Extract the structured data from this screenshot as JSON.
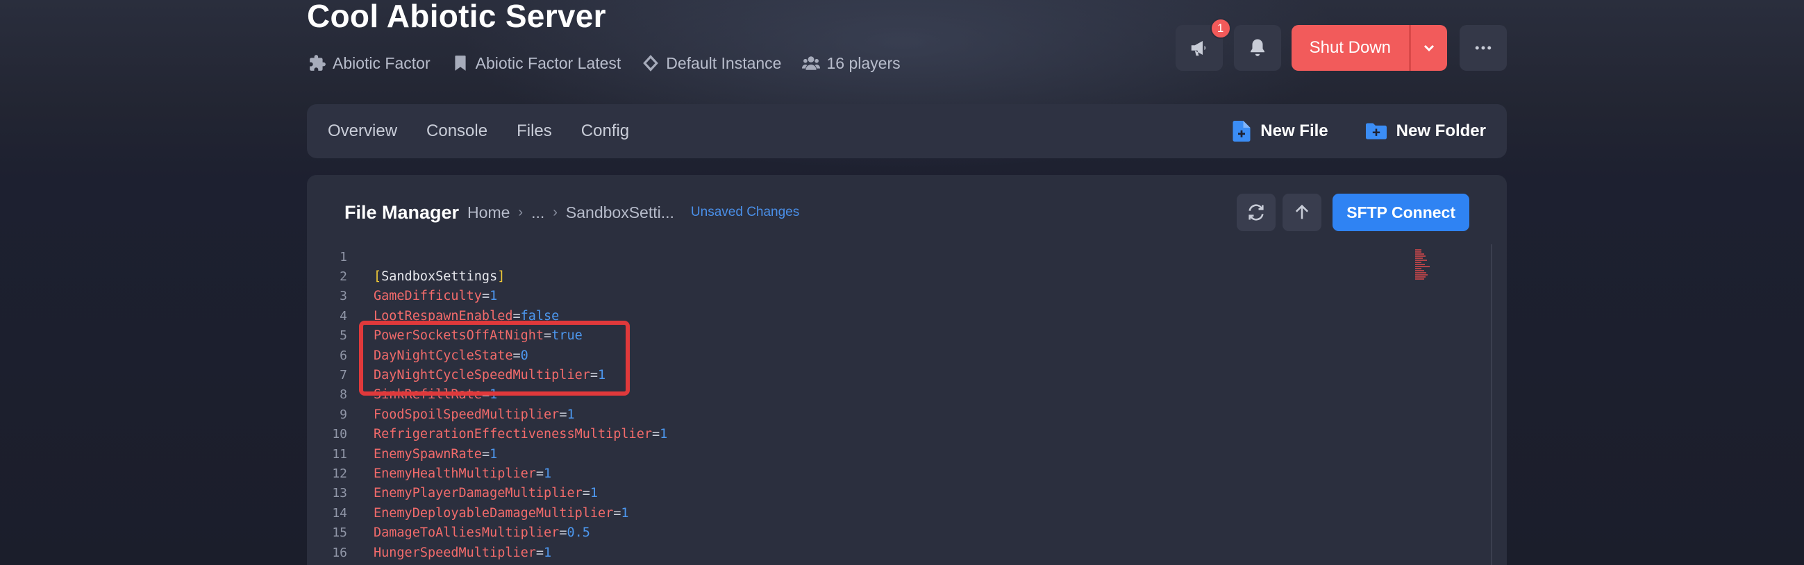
{
  "header": {
    "title": "Cool Abiotic Server",
    "meta": [
      {
        "icon": "puzzle-icon",
        "label": "Abiotic Factor"
      },
      {
        "icon": "bookmark-icon",
        "label": "Abiotic Factor Latest"
      },
      {
        "icon": "layers-icon",
        "label": "Default Instance"
      },
      {
        "icon": "users-icon",
        "label": "16 players"
      }
    ],
    "announce_badge": "1",
    "shutdown_label": "Shut Down"
  },
  "nav": {
    "tabs": [
      "Overview",
      "Console",
      "Files",
      "Config"
    ],
    "new_file_label": "New File",
    "new_folder_label": "New Folder"
  },
  "file_manager": {
    "title": "File Manager",
    "breadcrumbs": [
      "Home",
      "...",
      "SandboxSetti..."
    ],
    "status": "Unsaved Changes",
    "sftp_label": "SFTP Connect"
  },
  "editor": {
    "section_header": "SandboxSettings",
    "lines": [
      {
        "num": "1",
        "key": "",
        "value": "",
        "type": "empty"
      },
      {
        "num": "2",
        "key": "SandboxSettings",
        "value": "",
        "type": "section"
      },
      {
        "num": "3",
        "key": "GameDifficulty",
        "value": "1",
        "type": "kv"
      },
      {
        "num": "4",
        "key": "LootRespawnEnabled",
        "value": "false",
        "type": "kv"
      },
      {
        "num": "5",
        "key": "PowerSocketsOffAtNight",
        "value": "true",
        "type": "kv"
      },
      {
        "num": "6",
        "key": "DayNightCycleState",
        "value": "0",
        "type": "kv"
      },
      {
        "num": "7",
        "key": "DayNightCycleSpeedMultiplier",
        "value": "1",
        "type": "kv"
      },
      {
        "num": "8",
        "key": "SinkRefillRate",
        "value": "1",
        "type": "kv"
      },
      {
        "num": "9",
        "key": "FoodSpoilSpeedMultiplier",
        "value": "1",
        "type": "kv"
      },
      {
        "num": "10",
        "key": "RefrigerationEffectivenessMultiplier",
        "value": "1",
        "type": "kv"
      },
      {
        "num": "11",
        "key": "EnemySpawnRate",
        "value": "1",
        "type": "kv"
      },
      {
        "num": "12",
        "key": "EnemyHealthMultiplier",
        "value": "1",
        "type": "kv"
      },
      {
        "num": "13",
        "key": "EnemyPlayerDamageMultiplier",
        "value": "1",
        "type": "kv"
      },
      {
        "num": "14",
        "key": "EnemyDeployableDamageMultiplier",
        "value": "1",
        "type": "kv"
      },
      {
        "num": "15",
        "key": "DamageToAlliesMultiplier",
        "value": "0.5",
        "type": "kv"
      },
      {
        "num": "16",
        "key": "HungerSpeedMultiplier",
        "value": "1",
        "type": "kv"
      }
    ]
  },
  "colors": {
    "accent_red": "#f25b5b",
    "accent_blue": "#2f83f3",
    "key_color": "#f26b6b",
    "value_color": "#4d98f0",
    "highlight_box": "#e0393b"
  }
}
